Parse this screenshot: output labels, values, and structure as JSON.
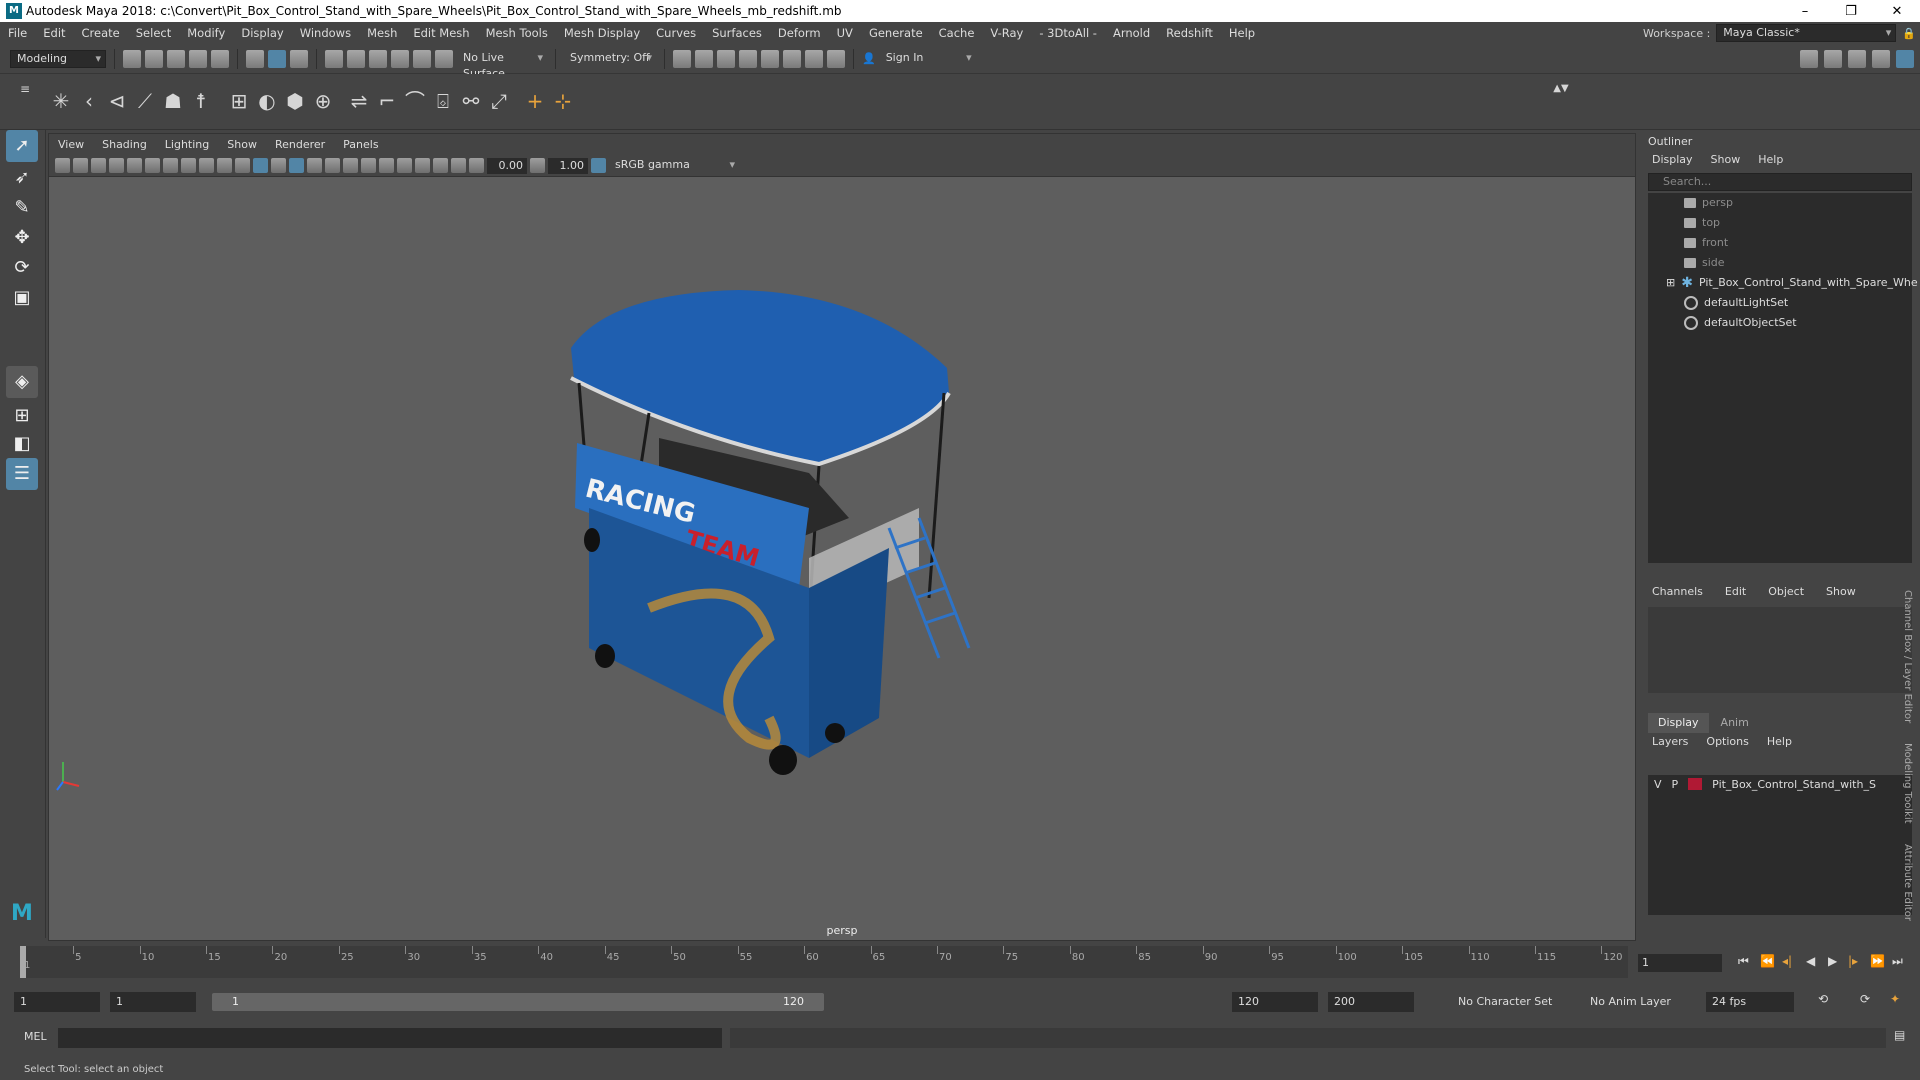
{
  "window": {
    "title": "Autodesk Maya 2018: c:\\Convert\\Pit_Box_Control_Stand_with_Spare_Wheels\\Pit_Box_Control_Stand_with_Spare_Wheels_mb_redshift.mb"
  },
  "menu": [
    "File",
    "Edit",
    "Create",
    "Select",
    "Modify",
    "Display",
    "Windows",
    "Mesh",
    "Edit Mesh",
    "Mesh Tools",
    "Mesh Display",
    "Curves",
    "Surfaces",
    "Deform",
    "UV",
    "Generate",
    "Cache",
    "V-Ray",
    "- 3DtoAll -",
    "Arnold",
    "Redshift",
    "Help"
  ],
  "workspace": {
    "label": "Workspace :",
    "value": "Maya Classic*"
  },
  "status": {
    "mode": "Modeling",
    "live_surface": "No Live Surface",
    "symmetry": "Symmetry: Off",
    "sign_in": "Sign In"
  },
  "viewport": {
    "menu": [
      "View",
      "Shading",
      "Lighting",
      "Show",
      "Renderer",
      "Panels"
    ],
    "exposure": "0.00",
    "gamma": "1.00",
    "color_space": "sRGB gamma",
    "camera": "persp",
    "model_text": {
      "racing": "RACING",
      "team": "TEAM"
    }
  },
  "outliner": {
    "title": "Outliner",
    "menu": [
      "Display",
      "Show",
      "Help"
    ],
    "search_placeholder": "Search...",
    "items": [
      {
        "label": "persp",
        "kind": "camera"
      },
      {
        "label": "top",
        "kind": "camera"
      },
      {
        "label": "front",
        "kind": "camera"
      },
      {
        "label": "side",
        "kind": "camera"
      },
      {
        "label": "Pit_Box_Control_Stand_with_Spare_Whe",
        "kind": "group"
      },
      {
        "label": "defaultLightSet",
        "kind": "set"
      },
      {
        "label": "defaultObjectSet",
        "kind": "set"
      }
    ]
  },
  "channel_box": {
    "menu": [
      "Channels",
      "Edit",
      "Object",
      "Show"
    ]
  },
  "layer_editor": {
    "tabs": [
      "Display",
      "Anim"
    ],
    "menu": [
      "Layers",
      "Options",
      "Help"
    ],
    "layer": {
      "v": "V",
      "p": "P",
      "name": "Pit_Box_Control_Stand_with_S",
      "color": "#b01934"
    }
  },
  "side_tabs": [
    "Channel Box / Layer Editor",
    "Modeling Toolkit",
    "Attribute Editor"
  ],
  "timeline": {
    "ticks": [
      5,
      10,
      15,
      20,
      25,
      30,
      35,
      40,
      45,
      50,
      55,
      60,
      65,
      70,
      75,
      80,
      85,
      90,
      95,
      100,
      105,
      110,
      115,
      120
    ],
    "first": "1",
    "current_frame": "1"
  },
  "range": {
    "start": "1",
    "playback_start": "1",
    "slider_start": "1",
    "slider_end": "120",
    "playback_end": "120",
    "end": "200",
    "character_set": "No Character Set",
    "anim_layer": "No Anim Layer",
    "fps": "24 fps"
  },
  "command_line": {
    "label": "MEL"
  },
  "help_line": "Select Tool: select an object"
}
